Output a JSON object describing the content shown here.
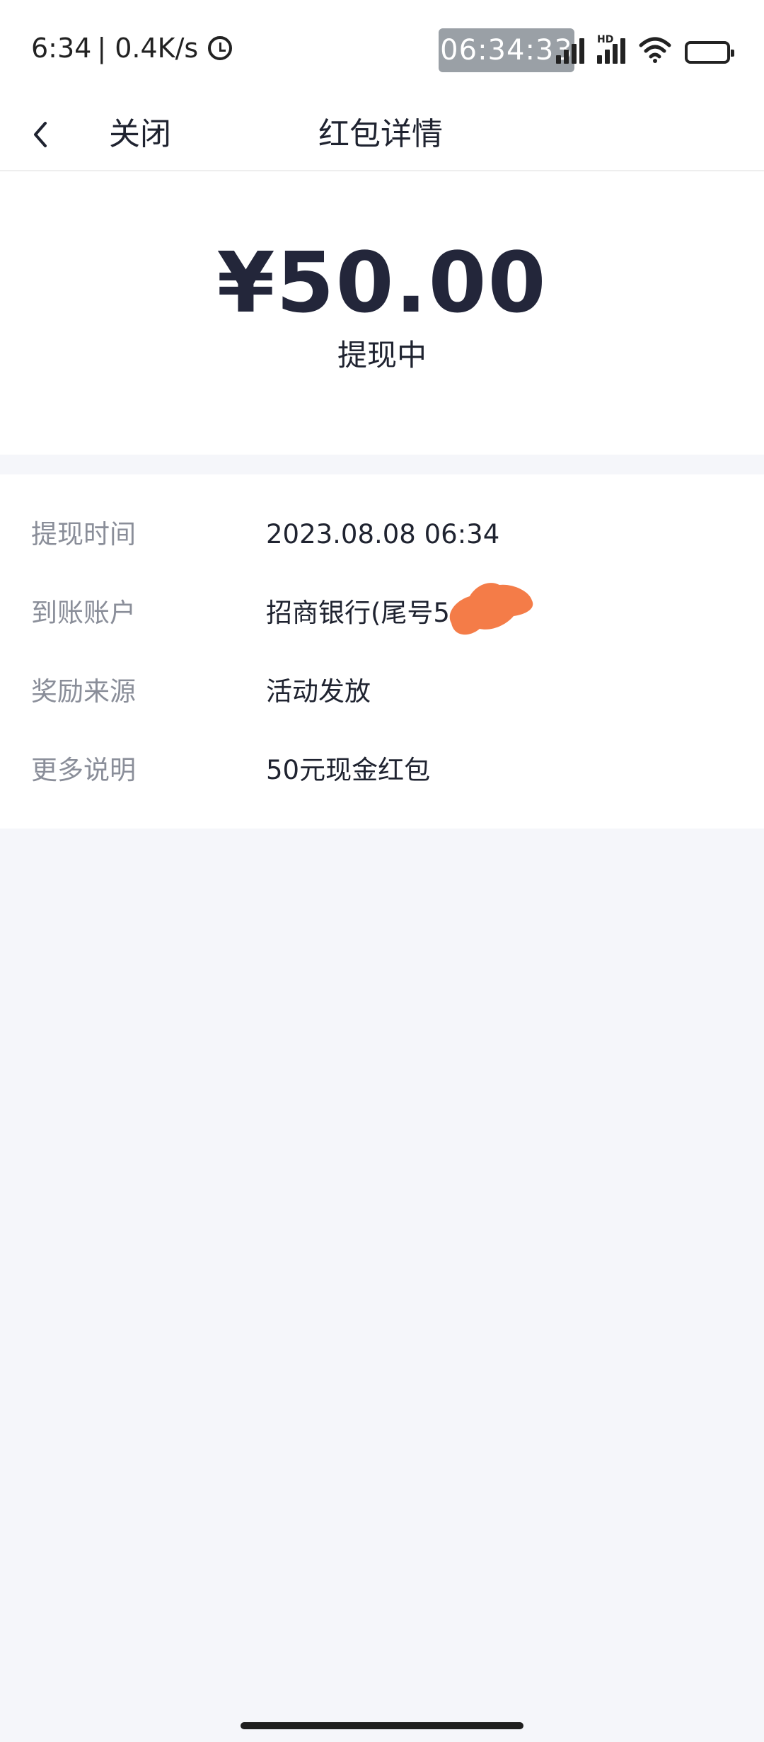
{
  "status_bar": {
    "time": "6:34",
    "net_speed": "| 0.4K/s",
    "overlay_clock": "06:34:33",
    "network_tag": "HD",
    "icons": [
      "alarm-icon",
      "signal-icon",
      "signal-icon",
      "wifi-icon",
      "battery-icon"
    ]
  },
  "nav": {
    "back_icon": "chevron-left-icon",
    "close_label": "关闭",
    "title": "红包详情"
  },
  "amount": {
    "value": "¥50.00",
    "status": "提现中"
  },
  "details": [
    {
      "label": "提现时间",
      "value": "2023.08.08 06:34"
    },
    {
      "label": "到账账户",
      "value": "招商银行(尾号5"
    },
    {
      "label": "奖励来源",
      "value": "活动发放"
    },
    {
      "label": "更多说明",
      "value": "50元现金红包"
    }
  ],
  "colors": {
    "page_background": "#f5f6fa",
    "card_background": "#ffffff",
    "amount_text": "#23263a",
    "label_text": "#8a8e99",
    "redaction": "#f47c48"
  }
}
